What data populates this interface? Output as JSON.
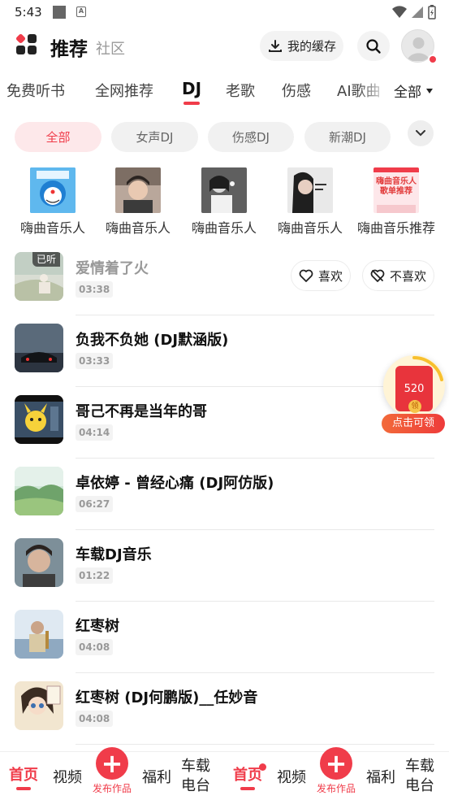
{
  "status_bar": {
    "time": "5:43"
  },
  "header": {
    "title": "推荐",
    "subtitle": "社区",
    "cache_label": "我的缓存"
  },
  "tabs": [
    "免费听书",
    "全网推荐",
    "DJ",
    "老歌",
    "伤感",
    "AI歌曲"
  ],
  "tabs_all": "全部",
  "chips": [
    "全部",
    "女声DJ",
    "伤感DJ",
    "新潮DJ"
  ],
  "artists": [
    {
      "name": "嗨曲音乐人"
    },
    {
      "name": "嗨曲音乐人"
    },
    {
      "name": "嗨曲音乐人"
    },
    {
      "name": "嗨曲音乐人"
    },
    {
      "name": "嗨曲音乐推荐",
      "cover_text": "嗨曲音乐人\n歌单推荐"
    }
  ],
  "songs": [
    {
      "title": "爱情着了火",
      "duration": "03:38",
      "badge": "已听",
      "like": "喜欢",
      "dislike": "不喜欢"
    },
    {
      "title": "负我不负她 (DJ默涵版)",
      "duration": "03:33"
    },
    {
      "title": "哥己不再是当年的哥",
      "duration": "04:14"
    },
    {
      "title": "卓依婷 - 曾经心痛 (DJ阿仿版)",
      "duration": "06:27"
    },
    {
      "title": "车载DJ音乐",
      "duration": "01:22"
    },
    {
      "title": "红枣树",
      "duration": "04:08"
    },
    {
      "title": "红枣树 (DJ何鹏版)__任妙音",
      "duration": "04:08"
    }
  ],
  "red_packet": {
    "amount": "520",
    "coin": "领",
    "cta": "点击可领"
  },
  "bottom_nav": {
    "home": "首页",
    "video": "视频",
    "publish": "发布作品",
    "welfare": "福利",
    "car_line1": "车载",
    "car_line2": "电台"
  },
  "colors": {
    "accent": "#f03c4a"
  }
}
